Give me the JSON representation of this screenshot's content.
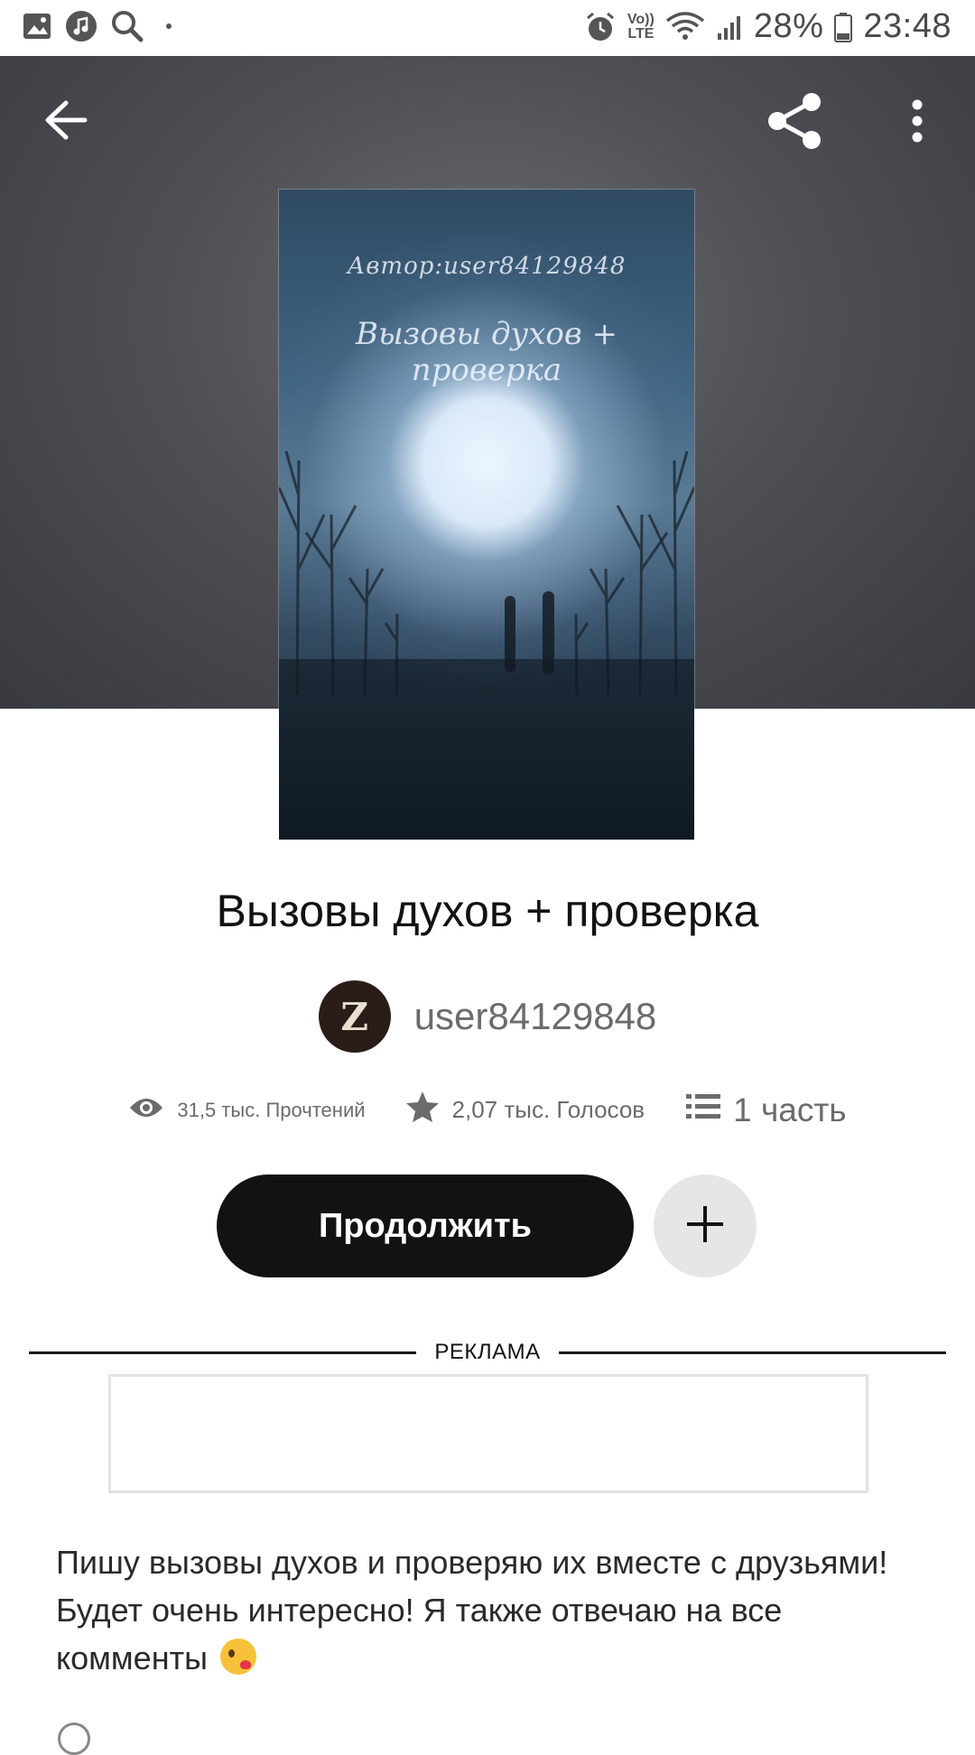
{
  "status_bar": {
    "battery_percent": "28%",
    "time": "23:48",
    "network_label_top": "Vo))",
    "network_label_bottom": "LTE",
    "left_icons": [
      "gallery-icon",
      "music-icon",
      "search-icon"
    ],
    "right_icons": [
      "alarm-icon",
      "volte-icon",
      "wifi-icon",
      "signal-icon",
      "battery-icon"
    ]
  },
  "header": {
    "icons": [
      "back-arrow-icon",
      "share-icon",
      "more-vert-icon"
    ]
  },
  "cover": {
    "author_text": "Автор:user84129848",
    "title_text": "Вызовы духов + проверка"
  },
  "story": {
    "title": "Вызовы духов + проверка",
    "author": "user84129848",
    "avatar_letter": "Z"
  },
  "stats": {
    "reads": "31,5 тыс. Прочтений",
    "votes": "2,07 тыс. Голосов",
    "parts": "1 часть"
  },
  "actions": {
    "continue_label": "Продолжить",
    "add_icon": "plus-icon"
  },
  "ad": {
    "label": "РЕКЛАМА"
  },
  "description": {
    "text": "Пишу вызовы духов и проверяю их вместе с друзьями! Будет очень интересно! Я также отвечаю на все комменты"
  },
  "colors": {
    "primary_button": "#121212",
    "secondary_button": "#e6e6e6",
    "header_bg": "#4e5056"
  }
}
